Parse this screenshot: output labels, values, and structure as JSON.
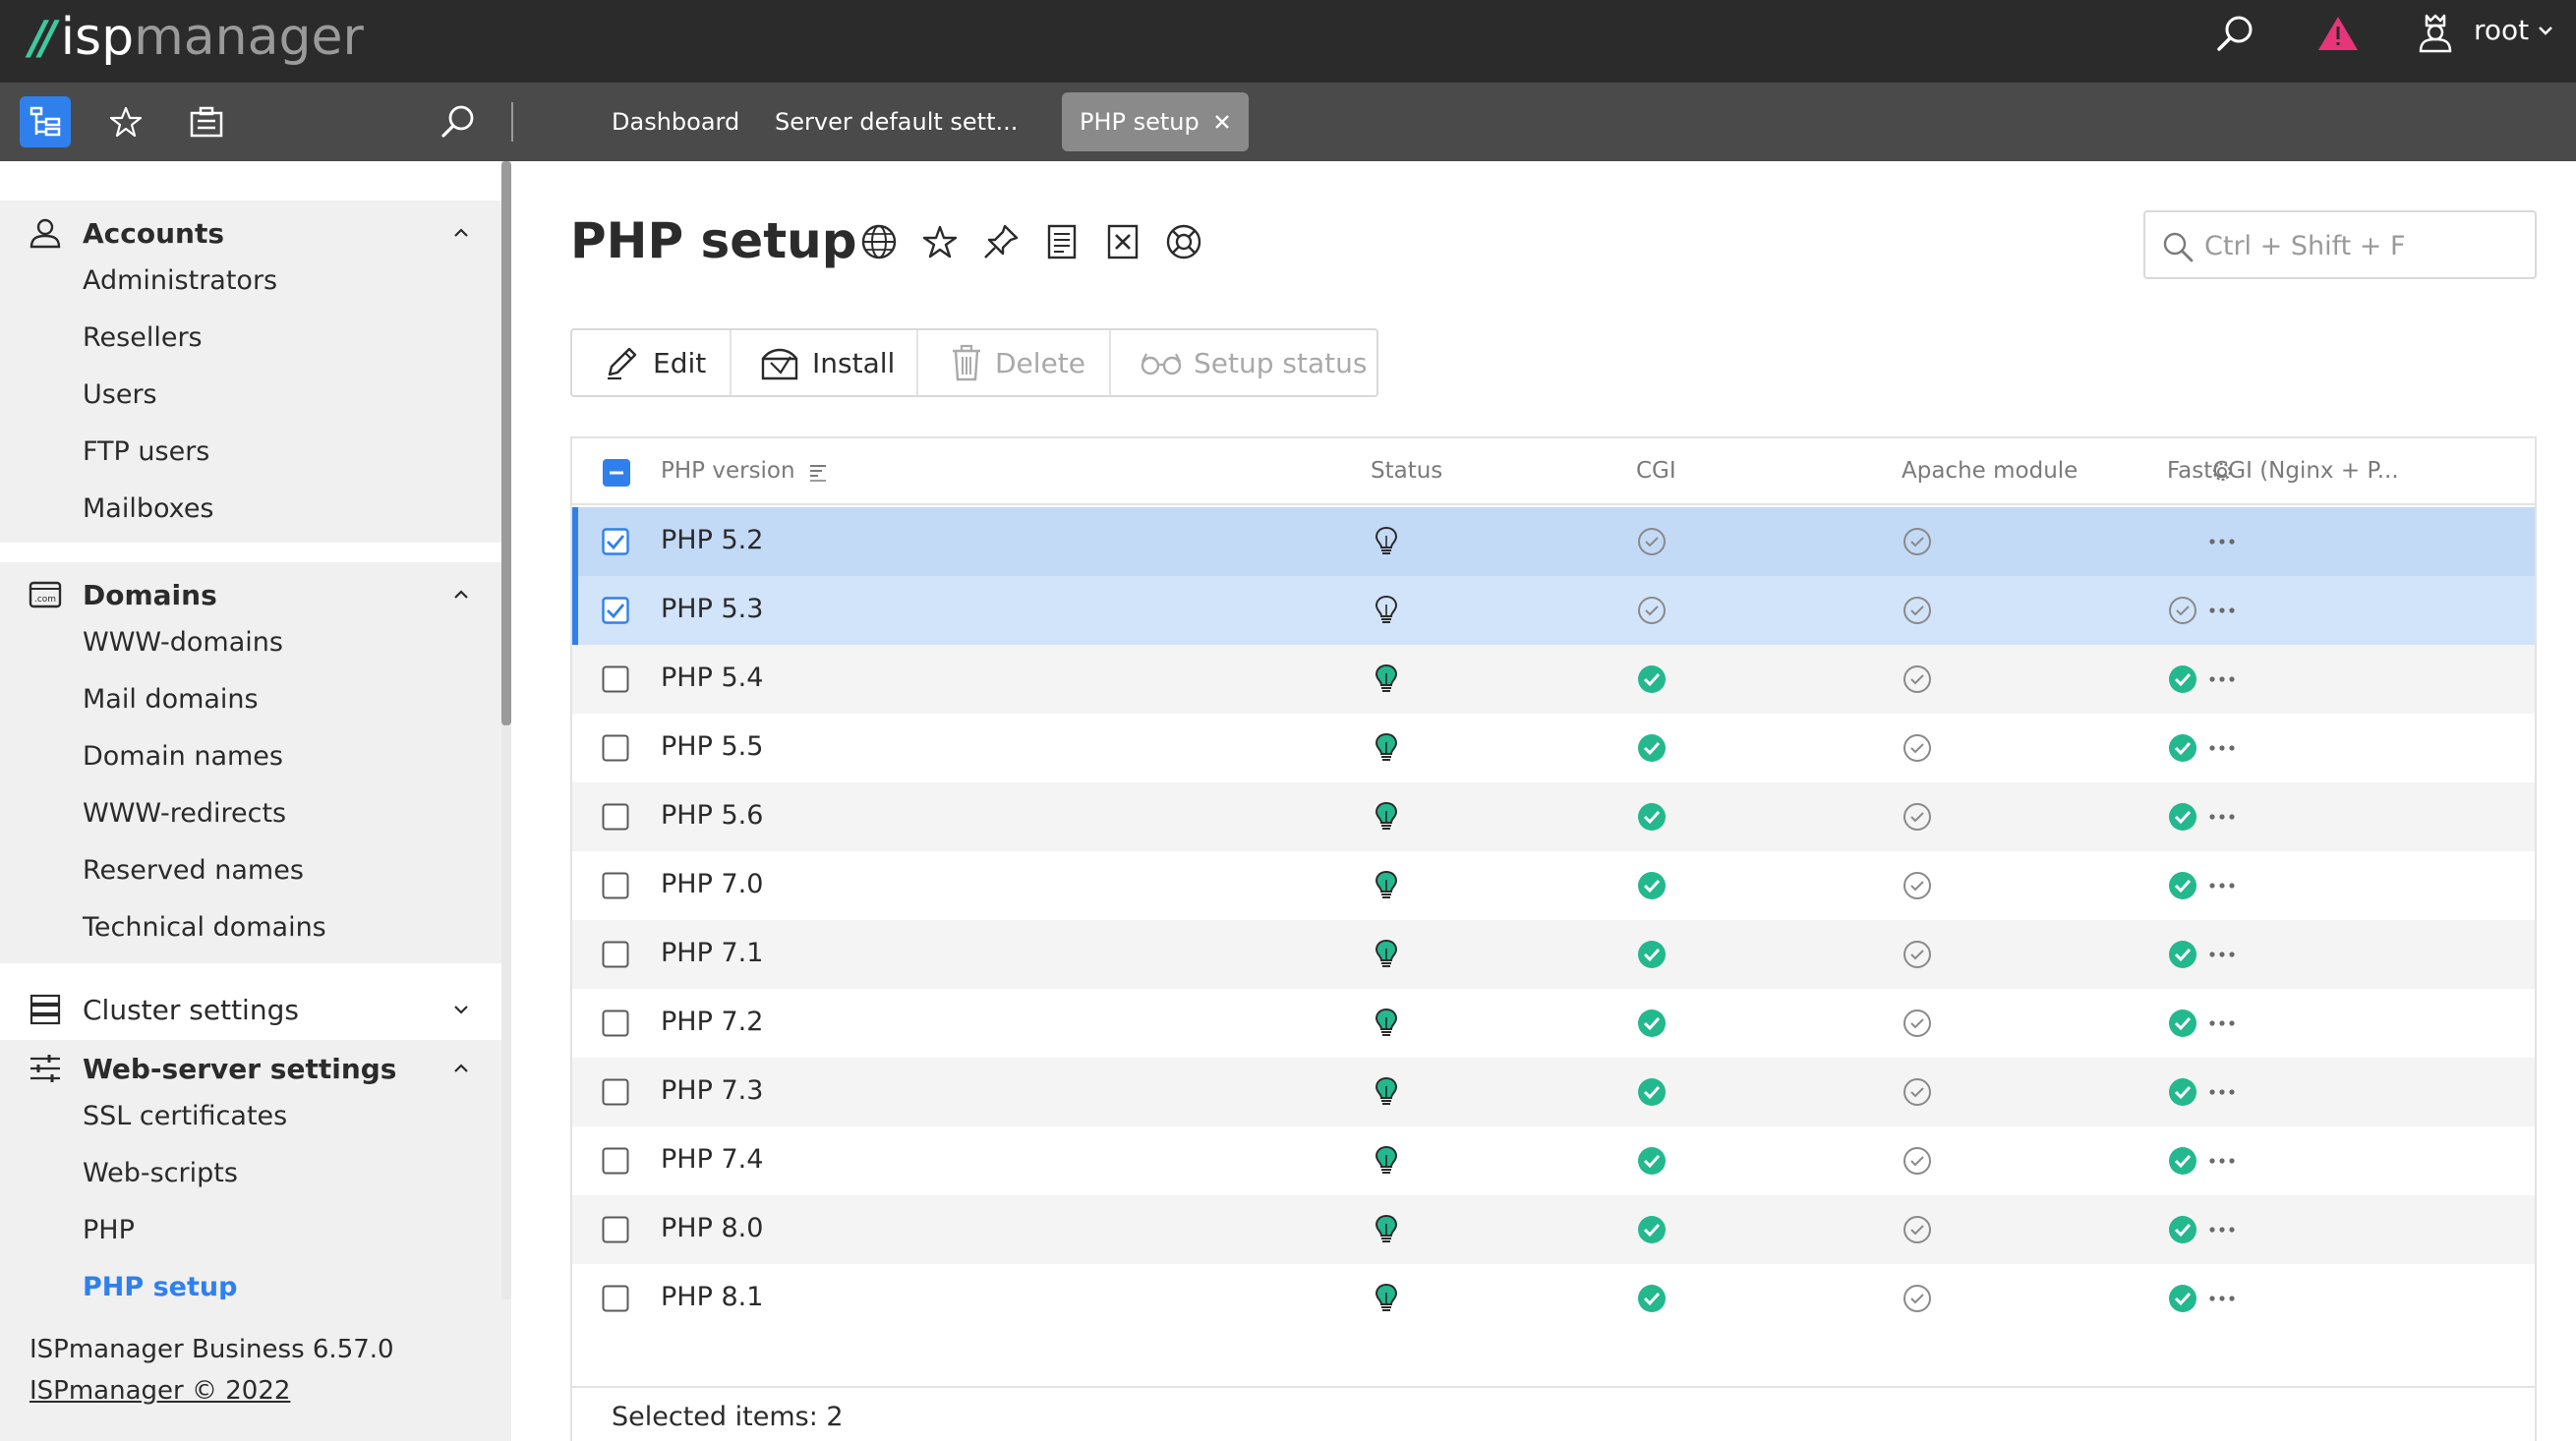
{
  "header": {
    "logo_isp": "isp",
    "logo_manager": "manager",
    "user_name": "root"
  },
  "tabs": [
    {
      "label": "Dashboard"
    },
    {
      "label": "Server default sett..."
    },
    {
      "label": "PHP setup"
    }
  ],
  "sidebar": {
    "groups": [
      {
        "label": "Accounts",
        "items": [
          "Administrators",
          "Resellers",
          "Users",
          "FTP users",
          "Mailboxes"
        ]
      },
      {
        "label": "Domains",
        "items": [
          "WWW-domains",
          "Mail domains",
          "Domain names",
          "WWW-redirects",
          "Reserved names",
          "Technical domains"
        ]
      },
      {
        "label": "Cluster settings",
        "items": []
      },
      {
        "label": "Web-server settings",
        "items": [
          "SSL certificates",
          "Web-scripts",
          "PHP",
          "PHP setup"
        ]
      }
    ],
    "footer_line1": "ISPmanager Business 6.57.0",
    "footer_line2": "ISPmanager © 2022"
  },
  "main": {
    "title": "PHP setup",
    "search_placeholder": "Ctrl + Shift + F",
    "toolbar": {
      "edit": "Edit",
      "install": "Install",
      "delete": "Delete",
      "setup_status": "Setup status"
    },
    "columns": {
      "version": "PHP version",
      "status": "Status",
      "cgi": "CGI",
      "apache": "Apache module",
      "fastcgi": "FastCGI (Nginx + P..."
    },
    "rows": [
      {
        "version": "PHP 5.2",
        "selected": true,
        "status": "not-installed",
        "cgi": "off",
        "apache": "off",
        "fastcgi": "none"
      },
      {
        "version": "PHP 5.3",
        "selected": true,
        "status": "not-installed",
        "cgi": "off",
        "apache": "off",
        "fastcgi": "off"
      },
      {
        "version": "PHP 5.4",
        "selected": false,
        "status": "installed",
        "cgi": "on",
        "apache": "off",
        "fastcgi": "on"
      },
      {
        "version": "PHP 5.5",
        "selected": false,
        "status": "installed",
        "cgi": "on",
        "apache": "off",
        "fastcgi": "on"
      },
      {
        "version": "PHP 5.6",
        "selected": false,
        "status": "installed",
        "cgi": "on",
        "apache": "off",
        "fastcgi": "on"
      },
      {
        "version": "PHP 7.0",
        "selected": false,
        "status": "installed",
        "cgi": "on",
        "apache": "off",
        "fastcgi": "on"
      },
      {
        "version": "PHP 7.1",
        "selected": false,
        "status": "installed",
        "cgi": "on",
        "apache": "off",
        "fastcgi": "on"
      },
      {
        "version": "PHP 7.2",
        "selected": false,
        "status": "installed",
        "cgi": "on",
        "apache": "off",
        "fastcgi": "on"
      },
      {
        "version": "PHP 7.3",
        "selected": false,
        "status": "installed",
        "cgi": "on",
        "apache": "off",
        "fastcgi": "on"
      },
      {
        "version": "PHP 7.4",
        "selected": false,
        "status": "installed",
        "cgi": "on",
        "apache": "off",
        "fastcgi": "on"
      },
      {
        "version": "PHP 8.0",
        "selected": false,
        "status": "installed",
        "cgi": "on",
        "apache": "off",
        "fastcgi": "on"
      },
      {
        "version": "PHP 8.1",
        "selected": false,
        "status": "installed",
        "cgi": "on",
        "apache": "off",
        "fastcgi": "on"
      }
    ],
    "selected_items": "Selected items: 2"
  },
  "colors": {
    "accent": "#2f80ed",
    "success": "#24b88e",
    "alert": "#e8357a",
    "header_bg": "#2b2b2b",
    "tabbar_bg": "#4a4a4a"
  }
}
